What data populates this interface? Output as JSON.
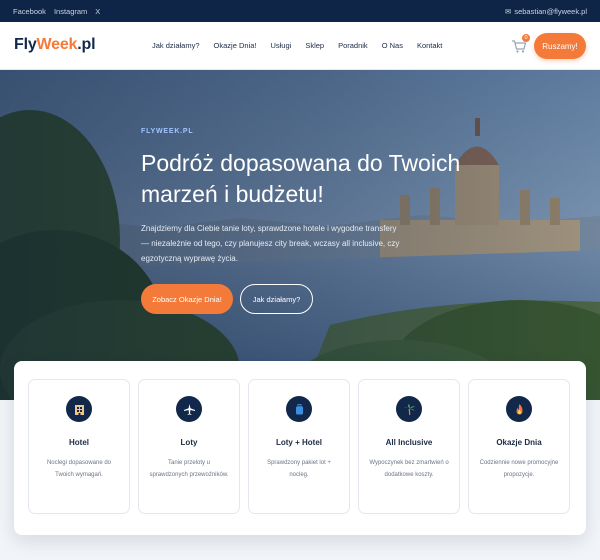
{
  "topbar": {
    "social": [
      "Facebook",
      "Instagram",
      "X"
    ],
    "email": "sebastian@flyweek.pl",
    "mail_icon": "✉"
  },
  "header": {
    "logo": {
      "part1": "Fly",
      "part2": "Week",
      "part3": ".pl"
    },
    "nav": [
      "Jak działamy?",
      "Okazje Dnia!",
      "Usługi",
      "Sklep",
      "Poradnik",
      "O Nas",
      "Kontakt"
    ],
    "cart_count": "0",
    "cta": "Ruszamy!"
  },
  "hero": {
    "eyebrow": "FLYWEEK.PL",
    "title": "Podróż dopasowana do Twoich marzeń i budżetu!",
    "text": "Znajdziemy dla Ciebie tanie loty, sprawdzone hotele i wygodne transfery — niezależnie od tego, czy planujesz city break, wczasy all inclusive, czy egzotyczną wyprawę życia.",
    "primary_button": "Zobacz Okazje Dnia!",
    "secondary_button": "Jak działamy?"
  },
  "services": [
    {
      "icon": "🏨",
      "icon_name": "hotel-icon",
      "title": "Hotel",
      "desc": "Noclegi dopasowane do Twoich wymagań."
    },
    {
      "icon": "✈",
      "icon_name": "plane-icon",
      "title": "Loty",
      "desc": "Tanie przeloty u sprawdzonych przewoźników."
    },
    {
      "icon": "🧳",
      "icon_name": "luggage-icon",
      "title": "Loty + Hotel",
      "desc": "Sprawdzony pakiet lot + nocleg."
    },
    {
      "icon": "🌴",
      "icon_name": "palm-icon",
      "title": "All Inclusive",
      "desc": "Wypoczynek bez zmartwień o dodatkowe koszty."
    },
    {
      "icon": "🔥",
      "icon_name": "fire-icon",
      "title": "Okazje Dnia",
      "desc": "Codziennie nowe promocyjne propozycje."
    }
  ],
  "colors": {
    "navy": "#12284a",
    "accent": "#f47a3a",
    "topbar": "#0f2547"
  }
}
